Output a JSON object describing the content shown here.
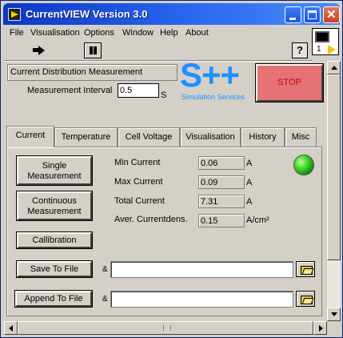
{
  "window": {
    "title": "CurrentVIEW Version 3.0"
  },
  "menu": [
    "File",
    "Visualisation",
    "Options",
    "Window",
    "Help",
    "About"
  ],
  "toolbar": {
    "help_label": "?",
    "vi_icon_number": "1"
  },
  "panel": {
    "title": "Current Distribution Measurement",
    "interval_label": "Measurement Interval",
    "interval_value": "0.5",
    "interval_unit": "S",
    "logo_text": "S++",
    "logo_sub": "Simulation Services",
    "stop_label": "STOP"
  },
  "tabs": [
    "Current",
    "Temperature",
    "Cell Voltage",
    "Visualisation",
    "History",
    "Misc"
  ],
  "active_tab": "Current",
  "current_tab": {
    "single_line1": "Single",
    "single_line2": "Measurement",
    "continuous_line1": "Continuous",
    "continuous_line2": "Measurement",
    "calibration": "Callibration",
    "save_to_file": "Save To File",
    "append_to_file": "Append To File",
    "path_tag": "&",
    "readings": [
      {
        "label": "Min Current",
        "value": "0.06",
        "unit": "A"
      },
      {
        "label": "Max Current",
        "value": "0.09",
        "unit": "A"
      },
      {
        "label": "Total Current",
        "value": "7.31",
        "unit": "A"
      },
      {
        "label": "Aver. Currentdens.",
        "value": "0.15",
        "unit": "A/cm²"
      }
    ],
    "led_color": "#2fcc20"
  }
}
